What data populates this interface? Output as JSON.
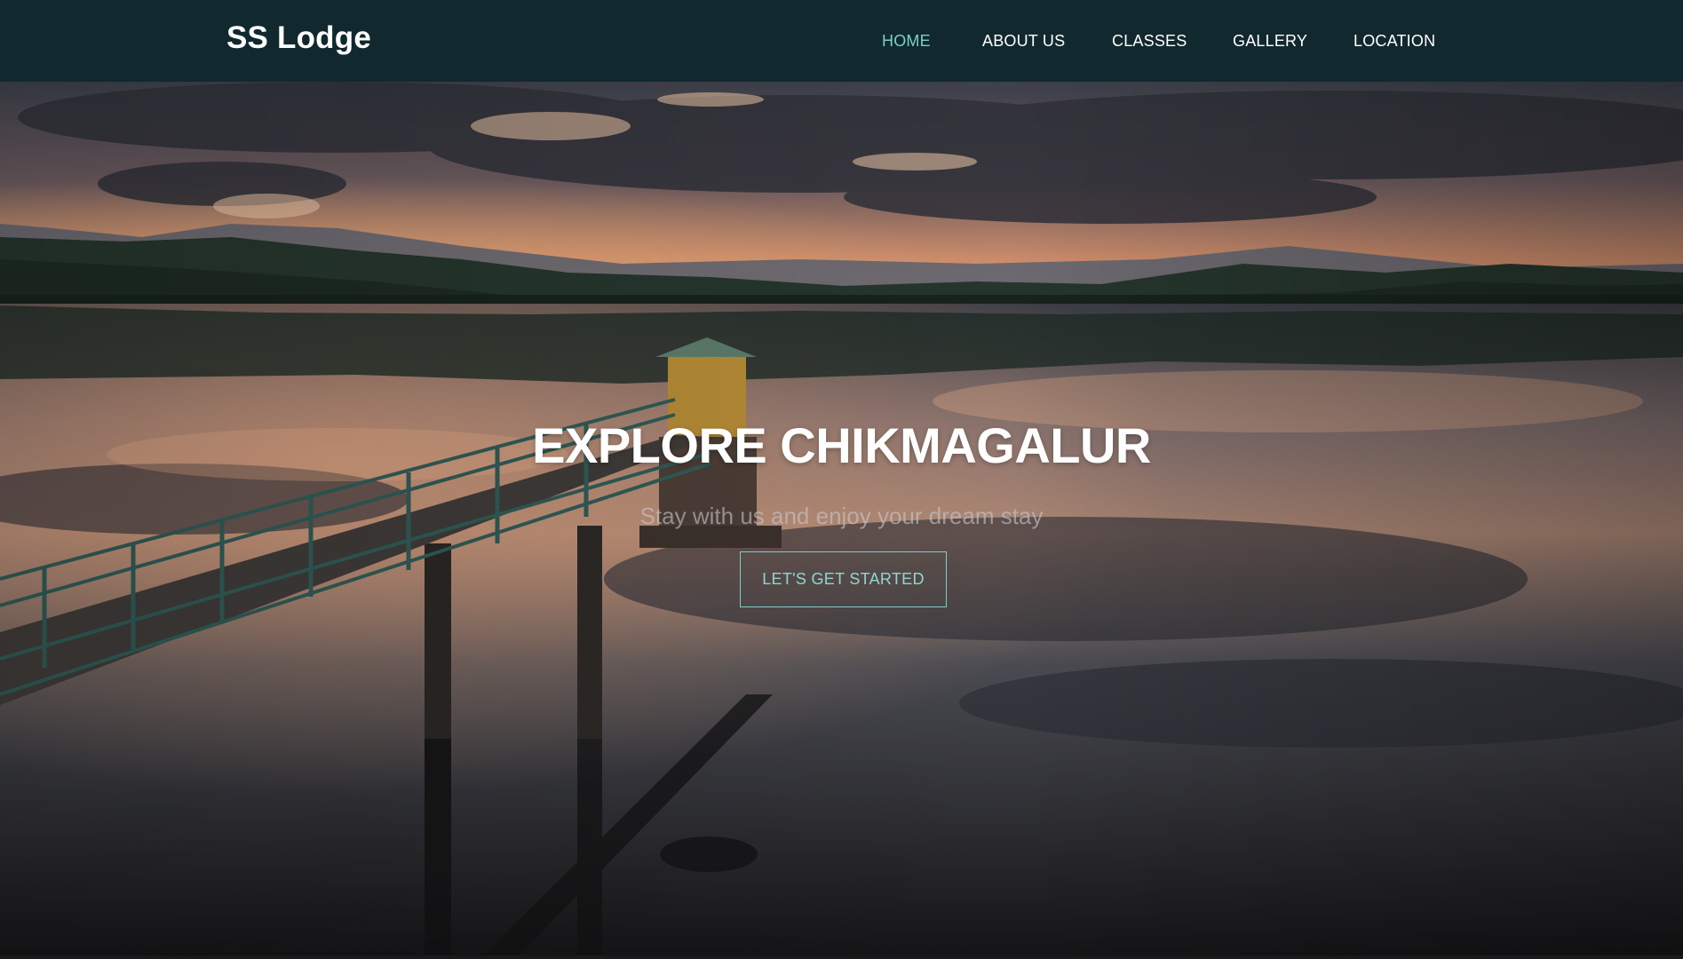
{
  "brand": {
    "name": "SS Lodge"
  },
  "nav": {
    "items": [
      {
        "label": "HOME",
        "active": true
      },
      {
        "label": "ABOUT US",
        "active": false
      },
      {
        "label": "CLASSES",
        "active": false
      },
      {
        "label": "GALLERY",
        "active": false
      },
      {
        "label": "LOCATION",
        "active": false
      }
    ]
  },
  "hero": {
    "title": "EXPLORE CHIKMAGALUR",
    "subtitle": "Stay with us and enjoy your dream stay",
    "cta_label": "LET'S GET STARTED",
    "background": "sunset-lake-pier-photo"
  },
  "colors": {
    "navbar_bg": "#11292e",
    "accent": "#7ccfc8",
    "text_light": "#ffffff"
  }
}
